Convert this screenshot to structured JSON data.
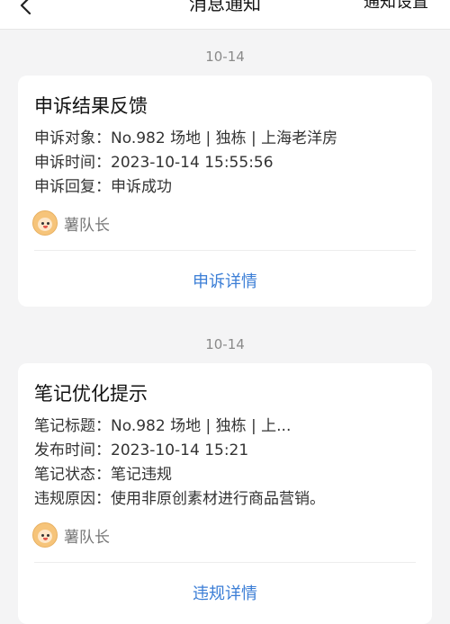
{
  "header": {
    "title": "消息通知",
    "settings_label": "通知设置"
  },
  "notifications": [
    {
      "date": "10-14",
      "title": "申诉结果反馈",
      "rows": [
        "申诉对象：No.982 场地 | 独栋 | 上海老洋房",
        "申诉时间：2023-10-14 15:55:56",
        "申诉回复：申诉成功"
      ],
      "sender": "薯队长",
      "link_label": "申诉详情"
    },
    {
      "date": "10-14",
      "title": "笔记优化提示",
      "rows": [
        "笔记标题：No.982 场地 | 独栋 | 上...",
        "发布时间：2023-10-14 15:21",
        "笔记状态：笔记违规",
        "违规原因：使用非原创素材进行商品营销。"
      ],
      "sender": "薯队长",
      "link_label": "违规详情"
    }
  ],
  "colors": {
    "background": "#f4f4f5",
    "card": "#ffffff",
    "link": "#3b7ed6",
    "muted": "#8a8a8a"
  },
  "icons": {
    "back": "chevron-left-icon",
    "avatar": "avatar-icon"
  }
}
